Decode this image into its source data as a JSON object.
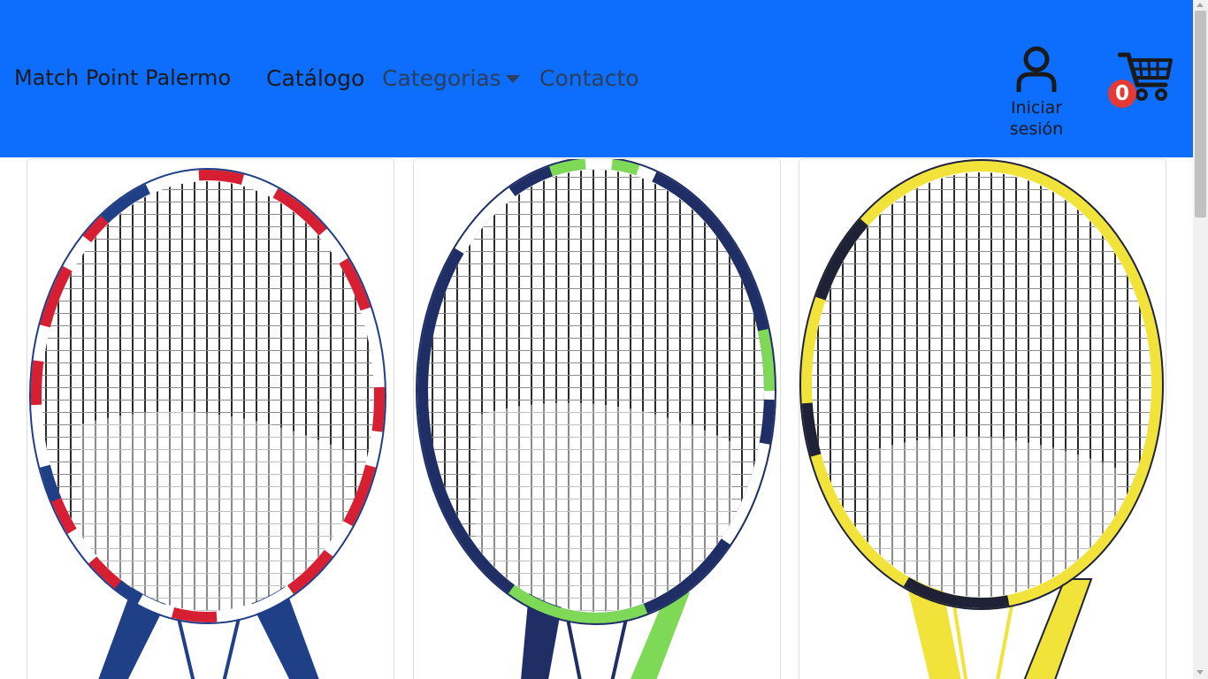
{
  "navbar": {
    "brand": "Match Point Palermo",
    "links": [
      {
        "label": "Catálogo"
      },
      {
        "label": "Categorias"
      },
      {
        "label": "Contacto"
      }
    ],
    "categorias_dropdown_icon": "caret-down-icon",
    "login": {
      "icon": "user-icon",
      "label": "Iniciar sesión"
    },
    "cart": {
      "icon": "shopping-cart-icon",
      "count": "0"
    },
    "background_color": "#0d6efd"
  },
  "products": [
    {
      "image": "tennis-racket-white-red-navy",
      "colors": [
        "#ffffff",
        "#d61f33",
        "#1f3f86"
      ]
    },
    {
      "image": "tennis-racket-navy-white-green",
      "colors": [
        "#1f2f66",
        "#ffffff",
        "#7ed957"
      ]
    },
    {
      "image": "tennis-racket-yellow-black",
      "colors": [
        "#f2e33a",
        "#1f2236"
      ]
    }
  ]
}
